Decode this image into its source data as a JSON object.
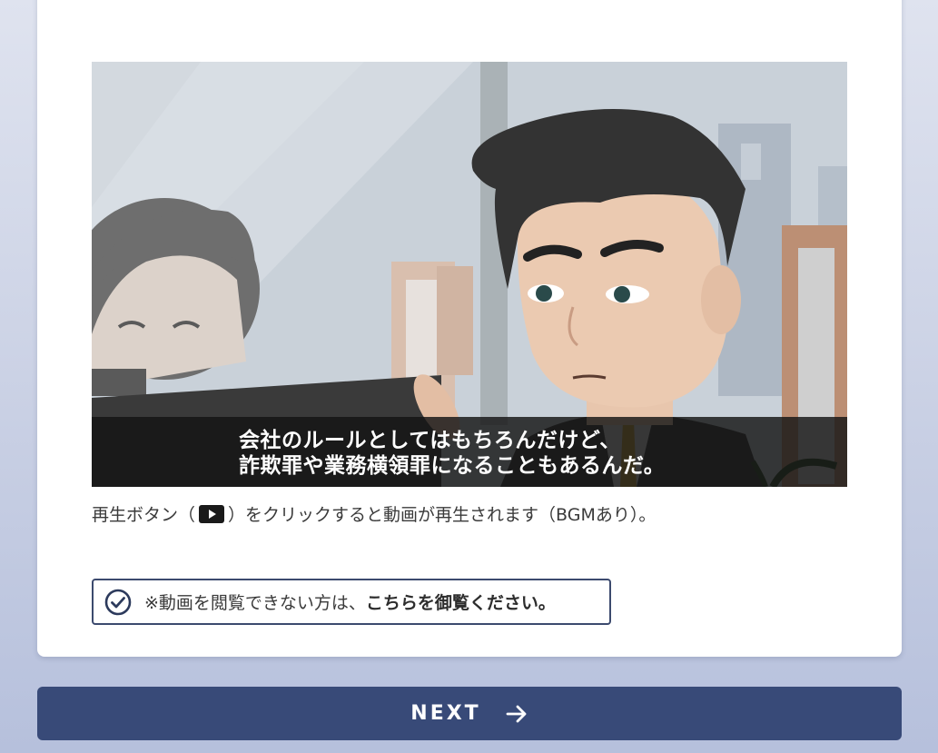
{
  "video": {
    "subtitle_line1": "会社のルールとしてはもちろんだけど、",
    "subtitle_line2": "詐欺罪や業務横領罪になることもあるんだ。"
  },
  "instruction": {
    "before_icon": "再生ボタン（",
    "play_icon": "play-icon",
    "after_icon": "）をクリックすると動画が再生されます（BGMあり）。"
  },
  "notice": {
    "icon": "check-circle-icon",
    "text": "※動画を閲覧できない方は、",
    "link": "こちらを御覧ください。"
  },
  "next_button": {
    "label": "NEXT",
    "icon": "arrow-right-icon"
  },
  "colors": {
    "accent": "#384a78",
    "border": "#3c4a6e",
    "card": "#ffffff"
  }
}
